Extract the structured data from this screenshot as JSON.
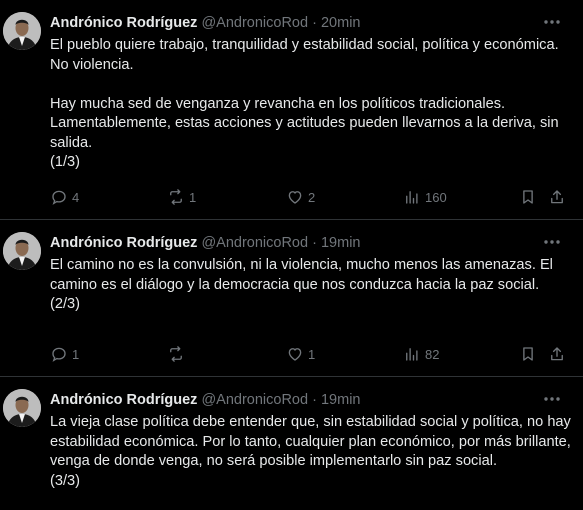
{
  "tweets": [
    {
      "name": "Andrónico Rodríguez",
      "handle": "@AndronicoRod",
      "separator": "·",
      "time": "20min",
      "text": "El pueblo quiere trabajo, tranquilidad y estabilidad social, política y económica. No violencia.\n\nHay mucha sed de venganza y revancha en los políticos tradicionales. Lamentablemente, estas acciones y actitudes pueden llevarnos a la deriva, sin salida.\n(1/3)",
      "replies": "4",
      "reposts": "1",
      "likes": "2",
      "views": "160"
    },
    {
      "name": "Andrónico Rodríguez",
      "handle": "@AndronicoRod",
      "separator": "·",
      "time": "19min",
      "text": "El camino no es la convulsión, ni la violencia, mucho menos las amenazas. El camino es el diálogo y la democracia que nos conduzca hacia la paz social.\n(2/3)",
      "replies": "1",
      "reposts": "",
      "likes": "1",
      "views": "82"
    },
    {
      "name": "Andrónico Rodríguez",
      "handle": "@AndronicoRod",
      "separator": "·",
      "time": "19min",
      "text": "La vieja clase política debe entender que, sin estabilidad social y política, no hay estabilidad económica. Por lo tanto, cualquier plan económico, por más brillante, venga de donde venga, no será posible implementarlo sin paz social.\n(3/3)"
    }
  ],
  "icons": {
    "more": "more-horizontal-icon",
    "reply": "reply-icon",
    "repost": "repost-icon",
    "like": "heart-icon",
    "views": "analytics-icon",
    "bookmark": "bookmark-icon",
    "share": "share-icon"
  },
  "colors": {
    "background": "#000000",
    "text": "#e7e9ea",
    "muted": "#71767b",
    "divider": "#2f3336"
  }
}
